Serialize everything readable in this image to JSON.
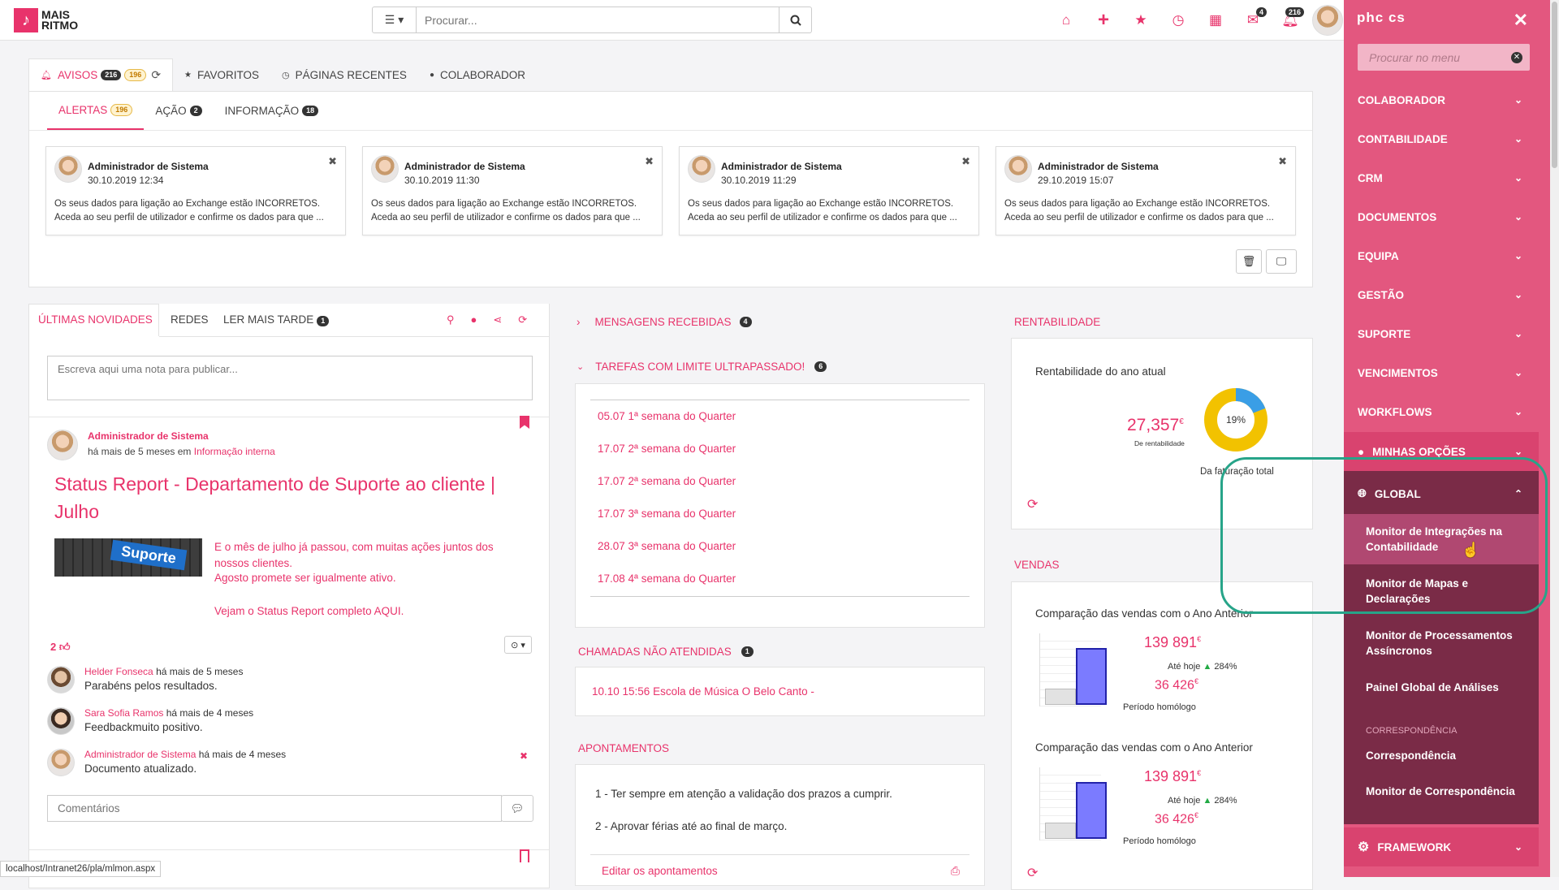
{
  "topbar": {
    "logo_line1": "MAIS",
    "logo_line2": "RITMO",
    "search_placeholder": "Procurar...",
    "mail_count": "4",
    "notif_count": "216"
  },
  "main_tabs": [
    {
      "label": "AVISOS",
      "badge1": "216",
      "badge2": "196"
    },
    {
      "label": "FAVORITOS"
    },
    {
      "label": "PÁGINAS RECENTES"
    },
    {
      "label": "COLABORADOR"
    }
  ],
  "alert_tabs": [
    {
      "label": "ALERTAS",
      "badge": "196"
    },
    {
      "label": "AÇÃO",
      "badge": "2"
    },
    {
      "label": "INFORMAÇÃO",
      "badge": "18"
    }
  ],
  "alerts": [
    {
      "name": "Administrador de Sistema",
      "date": "30.10.2019 12:34",
      "line1": "Os seus dados para ligação ao Exchange estão INCORRETOS.",
      "line2": "Aceda ao seu perfil de utilizador e confirme os dados para que ..."
    },
    {
      "name": "Administrador de Sistema",
      "date": "30.10.2019 11:30",
      "line1": "Os seus dados para ligação ao Exchange estão INCORRETOS.",
      "line2": "Aceda ao seu perfil de utilizador e confirme os dados para que ..."
    },
    {
      "name": "Administrador de Sistema",
      "date": "30.10.2019 11:29",
      "line1": "Os seus dados para ligação ao Exchange estão INCORRETOS.",
      "line2": "Aceda ao seu perfil de utilizador e confirme os dados para que ..."
    },
    {
      "name": "Administrador de Sistema",
      "date": "29.10.2019 15:07",
      "line1": "Os seus dados para ligação ao Exchange estão INCORRETOS.",
      "line2": "Aceda ao seu perfil de utilizador e confirme os dados para que ..."
    }
  ],
  "news": {
    "tabs": [
      {
        "label": "ÚLTIMAS NOVIDADES"
      },
      {
        "label": "REDES"
      },
      {
        "label": "LER MAIS TARDE",
        "badge": "1"
      }
    ],
    "note_placeholder": "Escreva aqui uma nota para publicar...",
    "author": "Administrador de Sistema",
    "meta_prefix": "há mais de 5 meses em",
    "meta_link": "Informação interna",
    "title": "Status Report - Departamento de Suporte ao cliente | Julho",
    "thumb_label": "Suporte",
    "body1": "E o mês de julho já passou, com muitas ações juntos dos nossos clientes.",
    "body2": "Agosto promete ser igualmente ativo.",
    "body3": "Vejam o Status Report completo AQUI.",
    "likes": "2",
    "comments": [
      {
        "author": "Helder Fonseca",
        "time": "há mais de 5 meses",
        "text": "Parabéns pelos resultados."
      },
      {
        "author": "Sara Sofia Ramos",
        "time": "há mais de 4 meses",
        "text": "Feedbackmuito positivo."
      },
      {
        "author": "Administrador de Sistema",
        "time": "há mais de 4 meses",
        "text": "Documento atualizado."
      }
    ],
    "comment_placeholder": "Comentários"
  },
  "messages": {
    "title": "MENSAGENS RECEBIDAS",
    "badge": "4"
  },
  "tasks": {
    "title": "TAREFAS COM LIMITE ULTRAPASSADO!",
    "badge": "6",
    "items": [
      "05.07 1ª semana do Quarter",
      "17.07 2ª semana do Quarter",
      "17.07 2ª semana do Quarter",
      "17.07 3ª semana do Quarter",
      "28.07 3ª semana do Quarter",
      "17.08 4ª semana do Quarter"
    ]
  },
  "calls": {
    "title": "CHAMADAS NÃO ATENDIDAS",
    "badge": "1",
    "item": "10.10 15:56 Escola de Música O Belo Canto -"
  },
  "appointments": {
    "title": "APONTAMENTOS",
    "items": [
      "1 - Ter sempre em atenção a validação dos prazos a cumprir.",
      "2 - Aprovar férias até ao final de março."
    ],
    "edit": "Editar os apontamentos"
  },
  "profit": {
    "title": "RENTABILIDADE",
    "subtitle": "Rentabilidade do ano atual",
    "value": "27,357",
    "currency": "€",
    "value_label": "De rentabilidade",
    "percent": "19%",
    "percent_value": 19,
    "donut_label": "Da faturação total"
  },
  "sales": {
    "title": "VENDAS",
    "cards": [
      {
        "subtitle": "Comparação das vendas com o Ano Anterior",
        "current": "139 891",
        "previous": "36 426",
        "currency": "€",
        "until_label": "Até hoje",
        "growth": "284%",
        "period": "Período homólogo"
      },
      {
        "subtitle": "Comparação das vendas com o Ano Anterior",
        "current": "139 891",
        "previous": "36 426",
        "currency": "€",
        "until_label": "Até hoje",
        "growth": "284%",
        "period": "Período homólogo"
      }
    ]
  },
  "sidebar": {
    "logo": "phc cs",
    "search_placeholder": "Procurar no menu",
    "items": [
      "COLABORADOR",
      "CONTABILIDADE",
      "CRM",
      "DOCUMENTOS",
      "EQUIPA",
      "GESTÃO",
      "SUPORTE",
      "VENCIMENTOS",
      "WORKFLOWS"
    ],
    "minhas": "MINHAS OPÇÕES",
    "global": "GLOBAL",
    "global_items": [
      "Monitor de Integrações na Contabilidade",
      "Monitor de Mapas e Declarações",
      "Monitor de Processamentos Assíncronos",
      "Painel Global de Análises"
    ],
    "group_label": "CORRESPONDÊNCIA",
    "group_items": [
      "Correspondência",
      "Monitor de Correspondência"
    ],
    "framework": "FRAMEWORK"
  },
  "status_url": "localhost/Intranet26/pla/mlmon.aspx",
  "colors": {
    "accent": "#e8336b",
    "sidebar": "#e3577f",
    "sidebar_dark": "#7a2b47",
    "highlight": "#27a489"
  }
}
